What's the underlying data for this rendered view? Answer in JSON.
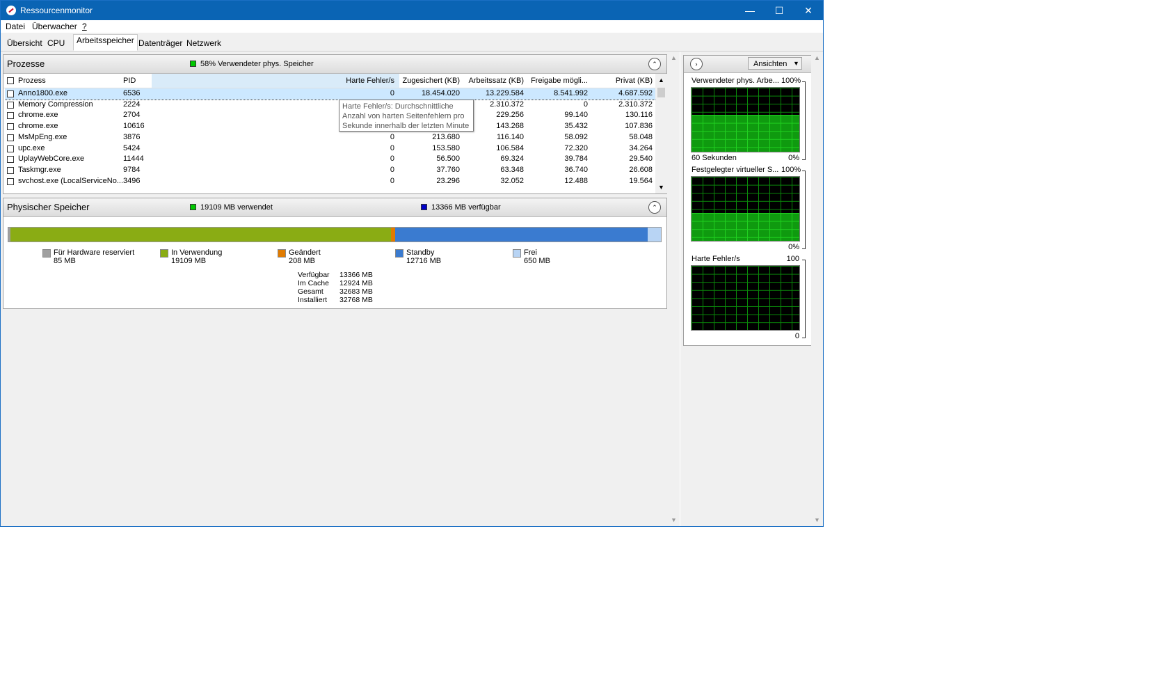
{
  "window": {
    "title": "Ressourcenmonitor",
    "controls": [
      "—",
      "☐",
      "✕"
    ]
  },
  "menu": [
    "Datei",
    "Überwacher",
    "?"
  ],
  "tabs": [
    {
      "label": "Übersicht",
      "active": false
    },
    {
      "label": "CPU",
      "active": false
    },
    {
      "label": "Arbeitsspeicher",
      "active": true
    },
    {
      "label": "Datenträger",
      "active": false
    },
    {
      "label": "Netzwerk",
      "active": false
    }
  ],
  "processes": {
    "title": "Prozesse",
    "summary": "58% Verwendeter phys. Speicher",
    "summary_color": "#00c800",
    "columns": [
      "Prozess",
      "PID",
      "Harte Fehler/s",
      "Zugesichert (KB)",
      "Arbeitssatz (KB)",
      "Freigabe mögli...",
      "Privat (KB)"
    ],
    "rows": [
      [
        "Anno1800.exe",
        "6536",
        "0",
        "18.454.020",
        "13.229.584",
        "8.541.992",
        "4.687.592"
      ],
      [
        "Memory Compression",
        "2224",
        "",
        "",
        "2.310.372",
        "0",
        "2.310.372"
      ],
      [
        "chrome.exe",
        "2704",
        "",
        "",
        "229.256",
        "99.140",
        "130.116"
      ],
      [
        "chrome.exe",
        "10616",
        "",
        "",
        "143.268",
        "35.432",
        "107.836"
      ],
      [
        "MsMpEng.exe",
        "3876",
        "0",
        "213.680",
        "116.140",
        "58.092",
        "58.048"
      ],
      [
        "upc.exe",
        "5424",
        "0",
        "153.580",
        "106.584",
        "72.320",
        "34.264"
      ],
      [
        "UplayWebCore.exe",
        "11444",
        "0",
        "56.500",
        "69.324",
        "39.784",
        "29.540"
      ],
      [
        "Taskmgr.exe",
        "9784",
        "0",
        "37.760",
        "63.348",
        "36.740",
        "26.608"
      ],
      [
        "svchost.exe (LocalServiceNo...",
        "3496",
        "0",
        "23.296",
        "32.052",
        "12.488",
        "19.564"
      ]
    ],
    "tooltip": [
      "Harte Fehler/s: Durchschnittliche",
      "Anzahl von harten Seitenfehlern pro",
      "Sekunde innerhalb der letzten Minute"
    ]
  },
  "physical": {
    "title": "Physischer Speicher",
    "used_label": "19109 MB verwendet",
    "used_color": "#00c800",
    "avail_label": "13366 MB verfügbar",
    "avail_color": "#0000c8",
    "segments": [
      {
        "name": "Für Hardware reserviert",
        "value": "85 MB",
        "mb": 85,
        "color": "#a0a0a0"
      },
      {
        "name": "In Verwendung",
        "value": "19109 MB",
        "mb": 19109,
        "color": "#8aac14"
      },
      {
        "name": "Geändert",
        "value": "208 MB",
        "mb": 208,
        "color": "#e07b00"
      },
      {
        "name": "Standby",
        "value": "12716 MB",
        "mb": 12716,
        "color": "#3a7bd0"
      },
      {
        "name": "Frei",
        "value": "650 MB",
        "mb": 650,
        "color": "#b8d4f4"
      }
    ],
    "stats": [
      {
        "label": "Verfügbar",
        "value": "13366 MB"
      },
      {
        "label": "Im Cache",
        "value": "12924 MB"
      },
      {
        "label": "Gesamt",
        "value": "32683 MB"
      },
      {
        "label": "Installiert",
        "value": "32768 MB"
      }
    ]
  },
  "right": {
    "views_label": "Ansichten",
    "graphs": [
      {
        "title": "Verwendeter phys. Arbe...",
        "max": "100%",
        "min": "0%",
        "footer": "60 Sekunden",
        "fill_percent": 58
      },
      {
        "title": "Festgelegter virtueller S...",
        "max": "100%",
        "min": "0%",
        "footer": "",
        "fill_percent": 44
      },
      {
        "title": "Harte Fehler/s",
        "max": "100",
        "min": "0",
        "footer": "",
        "fill_percent": 0
      }
    ]
  }
}
